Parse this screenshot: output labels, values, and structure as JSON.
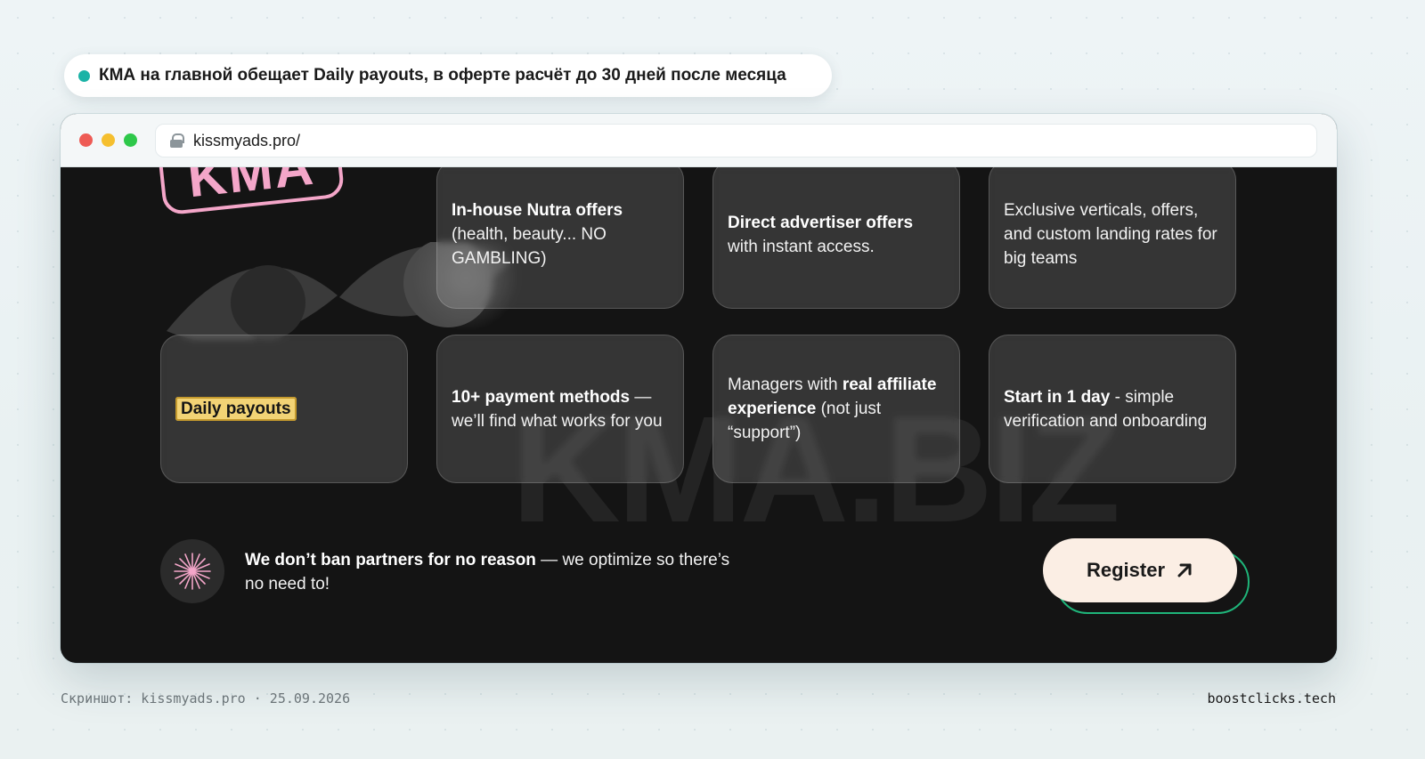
{
  "colors": {
    "accent_teal": "#1bb3a6",
    "accent_green": "#1fb57a",
    "logo_pink": "#f4a6c9",
    "highlight_yellow": "#f2d375",
    "button_bg": "#fbeee4",
    "traffic_red": "#ee5b55",
    "traffic_yellow": "#f5bf2f",
    "traffic_green": "#2ec84a"
  },
  "callout": {
    "text": "КМА на главной обещает Daily payouts, в оферте расчёт до 30 дней после месяца"
  },
  "browser": {
    "url": "kissmyads.pro/",
    "lock_icon": "lock-icon"
  },
  "site": {
    "logo": "KMA",
    "watermark": "KMA.BIZ",
    "cards": [
      {
        "bold": "In-house Nutra offers",
        "rest": " (health, beauty... NO GAMBLING)"
      },
      {
        "bold": "Direct advertiser offers",
        "rest": " with instant access."
      },
      {
        "bold": "",
        "rest": "Exclusive verticals, offers, and custom landing rates for big teams"
      },
      {
        "highlight": "Daily payouts"
      },
      {
        "bold": "10+ payment methods",
        "rest": " — we’ll find what works for you"
      },
      {
        "pre": "Managers with ",
        "bold": "real affiliate experience",
        "rest": " (not just “support”)"
      },
      {
        "bold": "Start in 1 day",
        "rest": " - simple verification and onboarding"
      }
    ],
    "bottom": {
      "bold": "We don’t ban partners for no reason",
      "rest": " — we optimize so there’s no need to!"
    },
    "register_label": "Register"
  },
  "footer": {
    "left": "Скриншот: kissmyads.pro · 25.09.2026",
    "right": "boostclicks.tech"
  }
}
